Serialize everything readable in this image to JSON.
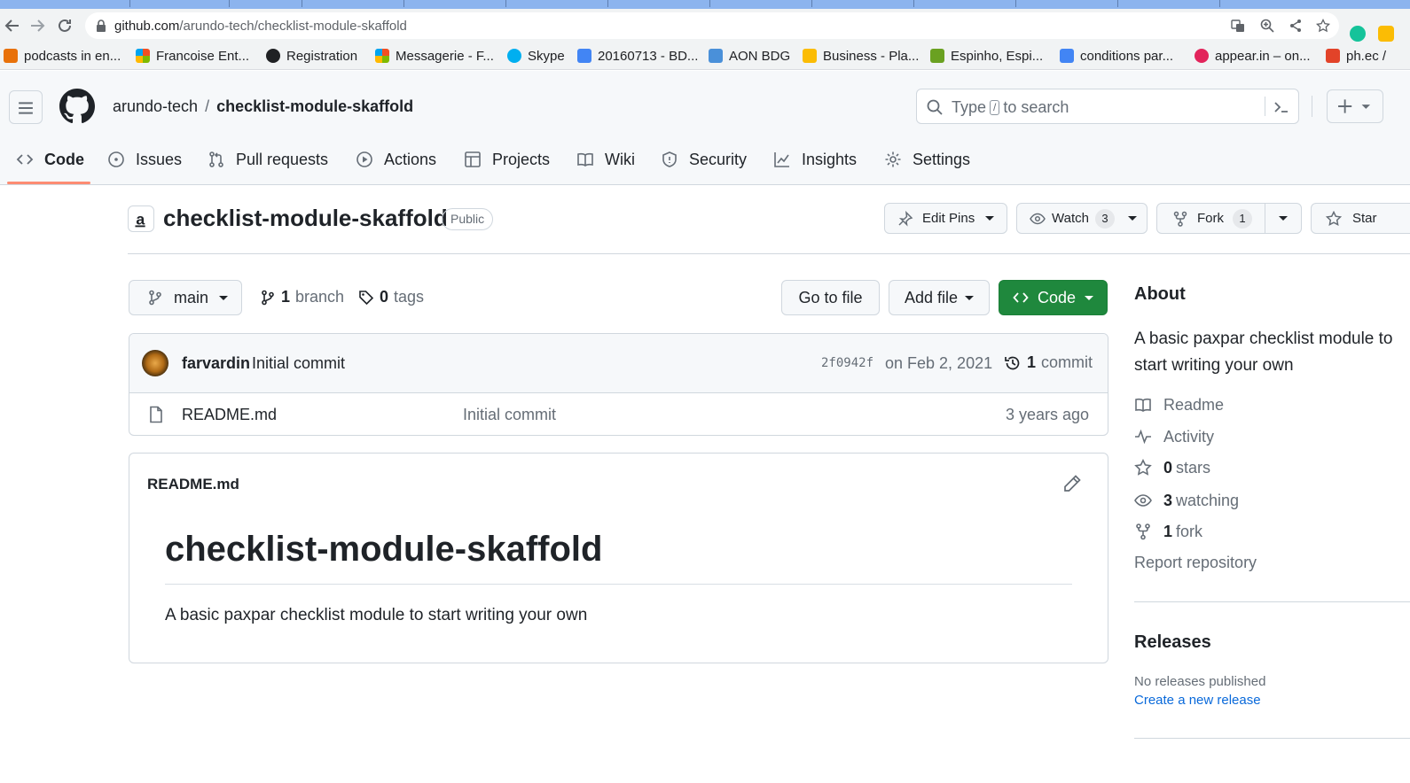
{
  "browser": {
    "url_host": "github.com",
    "url_path": "/arundo-tech/checklist-module-skaffold",
    "bookmarks": [
      {
        "label": "podcasts in en...",
        "color": "#e8710a"
      },
      {
        "label": "Francoise Ent...",
        "color": "#f25022"
      },
      {
        "label": "Registration",
        "color": "#202124"
      },
      {
        "label": "Messagerie - F...",
        "color": "#f25022"
      },
      {
        "label": "Skype",
        "color": "#00aff0"
      },
      {
        "label": "20160713 - BD...",
        "color": "#4285f4"
      },
      {
        "label": "AON BDG",
        "color": "#4a90d9"
      },
      {
        "label": "Business - Pla...",
        "color": "#fbbc04"
      },
      {
        "label": "Espinho, Espi...",
        "color": "#6aa121"
      },
      {
        "label": "conditions par...",
        "color": "#4285f4"
      },
      {
        "label": "appear.in – on...",
        "color": "#e2245b"
      },
      {
        "label": "ph.ec /",
        "color": "#e24329"
      }
    ]
  },
  "header": {
    "owner": "arundo-tech",
    "separator": "/",
    "repo": "checklist-module-skaffold",
    "search_pre": "Type",
    "search_key": "/",
    "search_post": "to search"
  },
  "tabs": {
    "code": "Code",
    "issues": "Issues",
    "pulls": "Pull requests",
    "actions": "Actions",
    "projects": "Projects",
    "wiki": "Wiki",
    "security": "Security",
    "insights": "Insights",
    "settings": "Settings"
  },
  "repo": {
    "title": "checklist-module-skaffold",
    "visibility": "Public",
    "edit_pins": "Edit Pins",
    "watch": "Watch",
    "watch_count": "3",
    "fork": "Fork",
    "fork_count": "1",
    "star": "Star"
  },
  "branchbar": {
    "branch": "main",
    "branch_count": "1",
    "branch_word": "branch",
    "tag_count": "0",
    "tag_word": "tags",
    "go_to_file": "Go to file",
    "add_file": "Add file",
    "code": "Code"
  },
  "commit": {
    "author": "farvardin",
    "message": "Initial commit",
    "sha": "2f0942f",
    "date": "on Feb 2, 2021",
    "count": "1",
    "count_word": "commit"
  },
  "files": [
    {
      "name": "README.md",
      "message": "Initial commit",
      "age": "3 years ago"
    }
  ],
  "readme": {
    "label": "README.md",
    "heading": "checklist-module-skaffold",
    "body": "A basic paxpar checklist module to start writing your own"
  },
  "sidebar": {
    "about_heading": "About",
    "description": "A basic paxpar checklist module to start writing your own",
    "readme": "Readme",
    "activity": "Activity",
    "stars_count": "0",
    "stars_word": "stars",
    "watching_count": "3",
    "watching_word": "watching",
    "forks_count": "1",
    "forks_word": "fork",
    "report": "Report repository",
    "releases_heading": "Releases",
    "no_releases": "No releases published",
    "create_release": "Create a new release"
  },
  "colors": {
    "primary_button": "#1f883d",
    "active_tab_underline": "#fd8c73",
    "link": "#0969da"
  }
}
